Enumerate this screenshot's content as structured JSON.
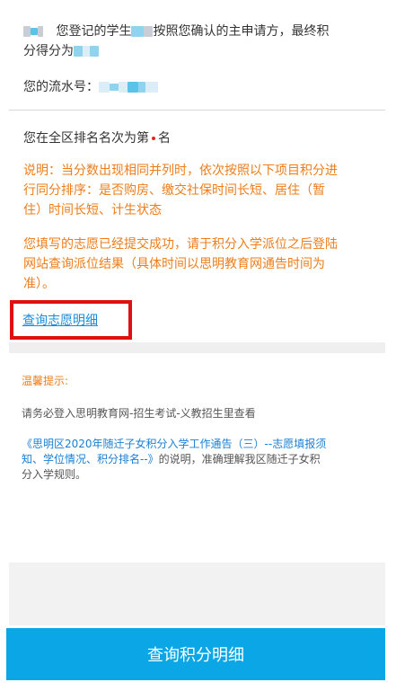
{
  "result": {
    "line1_part1": "您登记的学生",
    "line1_part2": "按照您确认的主申请方，最终积",
    "line2_prefix": "分得分为",
    "serial_label": "您的流水号："
  },
  "rank": {
    "prefix": "您在全区排名名次为第",
    "suffix": "名"
  },
  "notes": {
    "tie_rule_lines": [
      "说明：当分数出现相同并列时，依次按照以下项目积分进",
      "行同分排序：是否购房、缴交社保时间长短、居住（暂",
      "住）时间长短、计生状态"
    ],
    "submitted_lines": [
      "您填写的志愿已经提交成功，请于积分入学派位之后登陆",
      "网站查询派位结果（具体时间以思明教育网通告时间为",
      "准）。"
    ]
  },
  "links": {
    "view_choices": "查询志愿明细"
  },
  "tips": {
    "title": "温馨提示:",
    "line1": "请务必登入思明教育网-招生考试-义教招生里查看",
    "notice_link_lines": [
      "《思明区2020年随迁子女积分入学工作通告（三）--志愿填报须",
      "知、学位情况、积分排名--》"
    ],
    "notice_tail_first": "的说明，准确理解我区随迁子女积",
    "notice_tail_last": "分入学规则。"
  },
  "buttons": {
    "query_points": "查询积分明细"
  },
  "colors": {
    "orange": "#ee7d1a",
    "link_blue": "#1a8cd8",
    "button_blue": "#0aa6e6",
    "highlight_red": "#e01010"
  }
}
